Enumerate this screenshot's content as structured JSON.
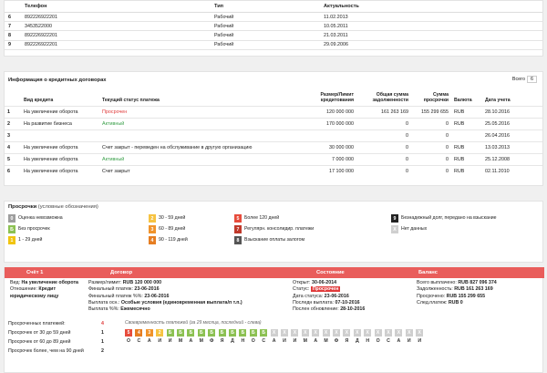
{
  "phones": {
    "headers": [
      "Телефон",
      "Тип",
      "Актуальность"
    ],
    "rows": [
      {
        "n": "6",
        "phone": "892226922201",
        "type": "Рабочий",
        "date": "11.02.2013"
      },
      {
        "n": "7",
        "phone": "3453522000",
        "type": "Рабочий",
        "date": "10.05.2011"
      },
      {
        "n": "8",
        "phone": "892226922201",
        "type": "Рабочий",
        "date": "21.03.2011"
      },
      {
        "n": "9",
        "phone": "892226922201",
        "type": "Рабочий",
        "date": "29.09.2006"
      }
    ]
  },
  "credits": {
    "title": "Информация о кредитных договорах",
    "count_label": "Всего",
    "count_value": "6",
    "headers": {
      "type": "Вид кредита",
      "status": "Текущий статус платежа",
      "limit": "Размер/Лимит кредитования",
      "debt": "Общая сумма задолженности",
      "overdue": "Сумма просрочки",
      "currency": "Валюта",
      "date": "Дата учета"
    },
    "rows": [
      {
        "n": "1",
        "type": "На увеличение оборота",
        "status": "Просрочен",
        "status_class": "red",
        "limit": "120 000 000",
        "debt": "161 263 169",
        "overdue": "155 299 655",
        "currency": "RUB",
        "date": "28.10.2016"
      },
      {
        "n": "2",
        "type": "На развитие бизнеса",
        "status": "Активный",
        "status_class": "green",
        "limit": "170 000 000",
        "debt": "0",
        "overdue": "0",
        "currency": "RUB",
        "date": "25.05.2016"
      },
      {
        "n": "3",
        "type": "",
        "status": "",
        "status_class": "",
        "limit": "",
        "debt": "0",
        "overdue": "0",
        "currency": "",
        "date": "26.04.2016"
      },
      {
        "n": "4",
        "type": "На увеличение оборота",
        "status": "Счет закрыт - переведен на обслуживание в другую организацию",
        "status_class": "",
        "limit": "30 000 000",
        "debt": "0",
        "overdue": "0",
        "currency": "RUB",
        "date": "13.03.2013"
      },
      {
        "n": "5",
        "type": "На увеличение оборота",
        "status": "Активный",
        "status_class": "green",
        "limit": "7 000 000",
        "debt": "0",
        "overdue": "0",
        "currency": "RUB",
        "date": "25.12.2008"
      },
      {
        "n": "6",
        "type": "На увеличение оборота",
        "status": "Счет закрыт",
        "status_class": "",
        "limit": "17 100 000",
        "debt": "0",
        "overdue": "0",
        "currency": "RUB",
        "date": "02.11.2010"
      }
    ]
  },
  "legend": {
    "title": "Просрочки",
    "subtitle": "(условные обозначения)",
    "items": [
      {
        "code": "0",
        "color": "#9e9e9e",
        "text": "Оценка невозможна"
      },
      {
        "code": "Б",
        "color": "#8cc152",
        "text": "Без просрочек"
      },
      {
        "code": "1",
        "color": "#f1c40f",
        "text": "1 - 29 дней"
      },
      {
        "code": "2",
        "color": "#f6c342",
        "text": "30 - 59 дней"
      },
      {
        "code": "3",
        "color": "#f0932b",
        "text": "60 - 89 дней"
      },
      {
        "code": "4",
        "color": "#e67e22",
        "text": "90 - 119 дней"
      },
      {
        "code": "5",
        "color": "#e74c3c",
        "text": "Более 120 дней"
      },
      {
        "code": "7",
        "color": "#c0392b",
        "text": "Регулярн. консолидир. платежи"
      },
      {
        "code": "8",
        "color": "#555555",
        "text": "Взыскание оплаты залогом"
      },
      {
        "code": "9",
        "color": "#222222",
        "text": "Безнадежный долг, передано на взыскание"
      },
      {
        "code": "X",
        "color": "#cfcfcf",
        "text": "Нет данных"
      }
    ]
  },
  "account": {
    "headers": {
      "account": "Счёт 1",
      "contract": "Договор",
      "state": "Состояние",
      "balance": "Баланс"
    },
    "kind_label": "Вид:",
    "kind_value": "На увеличение оборота",
    "relation_label": "Отношение:",
    "relation_value": "Кредит юридическому лицу",
    "limit_label": "Размер/лимит:",
    "limit_value": "RUB 120 000 000",
    "final_label": "Финальный платеж:",
    "final_value": "23-06-2016",
    "final_pct_label": "Финальный платеж %%:",
    "final_pct_value": "23-06-2016",
    "pay_type_label": "Выплата осн.:",
    "pay_type_value": "Особые условия (единовременная выплата/п т.п.)",
    "pay_pct_label": "Выплата %%:",
    "pay_pct_value": "Ежемесячно",
    "opened_label": "Открыт:",
    "opened_value": "30-06-2014",
    "status_label": "Статус:",
    "status_value": "Просрочен",
    "closing_label": "Дата статуса:",
    "closing_value": "23-06-2016",
    "last_pay_label": "Последн выплата:",
    "last_pay_value": "07-10-2016",
    "last_update_label": "Послен обновление:",
    "last_update_value": "28-10-2016",
    "paid_label": "Всего выплачено:",
    "paid_value": "RUB 827 096 374",
    "debt_label": "Задолженность:",
    "debt_value": "RUB 161 263 169",
    "overdue_label": "Просрочено:",
    "overdue_value": "RUB 155 299 655",
    "next_label": "След.платеж:",
    "next_value": "RUB 0"
  },
  "history": {
    "stats": [
      {
        "label": "Просроченных платежей:",
        "value": "4",
        "value_color": "#e03a3a"
      },
      {
        "label": "Просрочек от 30 до 59 дней",
        "value": "1",
        "value_color": "#222"
      },
      {
        "label": "Просрочек от 60 до 89 дней",
        "value": "1",
        "value_color": "#222"
      },
      {
        "label": "Просрочек более, чем на 90 дней",
        "value": "2",
        "value_color": "#222"
      }
    ],
    "caption": "Своевременность платежей (за 29 месяца, последний - слева)",
    "cells": [
      "5",
      "4",
      "3",
      "2",
      "Б",
      "Б",
      "Б",
      "Б",
      "Б",
      "Б",
      "Б",
      "Б",
      "Б",
      "Б",
      "X",
      "X",
      "X",
      "X",
      "X",
      "X",
      "X",
      "X",
      "X",
      "X",
      "X",
      "X",
      "X",
      "X",
      "X"
    ],
    "months": [
      "О",
      "С",
      "А",
      "И",
      "И",
      "М",
      "А",
      "М",
      "Ф",
      "Я",
      "Д",
      "Н",
      "О",
      "С",
      "А",
      "И",
      "И",
      "М",
      "А",
      "М",
      "Ф",
      "Я",
      "Д",
      "Н",
      "О",
      "С",
      "А",
      "И",
      "И"
    ],
    "colors": {
      "5": "#e74c3c",
      "4": "#e67e22",
      "3": "#f0932b",
      "2": "#f6c342",
      "Б": "#8cc152",
      "X": "#cfcfcf"
    }
  }
}
